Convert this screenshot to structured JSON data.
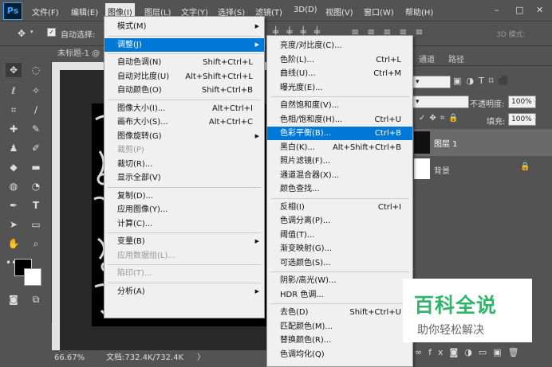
{
  "app": {
    "logo": "Ps"
  },
  "menubar": {
    "items": [
      "文件(F)",
      "编辑(E)",
      "图像(I)",
      "图层(L)",
      "文字(Y)",
      "选择(S)",
      "滤镜(T)",
      "3D(D)",
      "视图(V)",
      "窗口(W)",
      "帮助(H)"
    ],
    "window_controls": [
      "–",
      "□",
      "✕"
    ]
  },
  "options": {
    "auto_select_label": "自动选择:",
    "mode_label": "3D 模式:"
  },
  "document": {
    "tab_title": "未标题-1 @",
    "zoom": "66.67%",
    "doc_info": "文档:732.4K/732.4K",
    "status_arrow": "〉"
  },
  "image_menu": {
    "items": [
      {
        "label": "模式(M)",
        "shortcut": "",
        "submenu": true,
        "disabled": false
      },
      {
        "sep": true
      },
      {
        "label": "调整(J)",
        "shortcut": "",
        "submenu": true,
        "disabled": false,
        "highlight": true
      },
      {
        "sep": true
      },
      {
        "label": "自动色调(N)",
        "shortcut": "Shift+Ctrl+L"
      },
      {
        "label": "自动对比度(U)",
        "shortcut": "Alt+Shift+Ctrl+L"
      },
      {
        "label": "自动颜色(O)",
        "shortcut": "Shift+Ctrl+B"
      },
      {
        "sep": true
      },
      {
        "label": "图像大小(I)...",
        "shortcut": "Alt+Ctrl+I"
      },
      {
        "label": "画布大小(S)...",
        "shortcut": "Alt+Ctrl+C"
      },
      {
        "label": "图像旋转(G)",
        "shortcut": "",
        "submenu": true
      },
      {
        "label": "裁剪(P)",
        "shortcut": "",
        "disabled": true
      },
      {
        "label": "裁切(R)...",
        "shortcut": ""
      },
      {
        "label": "显示全部(V)",
        "shortcut": ""
      },
      {
        "sep": true
      },
      {
        "label": "复制(D)...",
        "shortcut": ""
      },
      {
        "label": "应用图像(Y)...",
        "shortcut": ""
      },
      {
        "label": "计算(C)...",
        "shortcut": ""
      },
      {
        "sep": true
      },
      {
        "label": "变量(B)",
        "shortcut": "",
        "submenu": true
      },
      {
        "label": "应用数据组(L)...",
        "shortcut": "",
        "disabled": true
      },
      {
        "sep": true
      },
      {
        "label": "陷印(T)...",
        "shortcut": "",
        "disabled": true
      },
      {
        "sep": true
      },
      {
        "label": "分析(A)",
        "shortcut": "",
        "submenu": true
      }
    ]
  },
  "adjust_menu": {
    "items": [
      {
        "label": "亮度/对比度(C)...",
        "shortcut": ""
      },
      {
        "label": "色阶(L)...",
        "shortcut": "Ctrl+L"
      },
      {
        "label": "曲线(U)...",
        "shortcut": "Ctrl+M"
      },
      {
        "label": "曝光度(E)...",
        "shortcut": ""
      },
      {
        "sep": true
      },
      {
        "label": "自然饱和度(V)...",
        "shortcut": ""
      },
      {
        "label": "色相/饱和度(H)...",
        "shortcut": "Ctrl+U"
      },
      {
        "label": "色彩平衡(B)...",
        "shortcut": "Ctrl+B",
        "highlight": true
      },
      {
        "label": "黑白(K)...",
        "shortcut": "Alt+Shift+Ctrl+B"
      },
      {
        "label": "照片滤镜(F)...",
        "shortcut": ""
      },
      {
        "label": "通道混合器(X)...",
        "shortcut": ""
      },
      {
        "label": "颜色查找...",
        "shortcut": ""
      },
      {
        "sep": true
      },
      {
        "label": "反相(I)",
        "shortcut": "Ctrl+I"
      },
      {
        "label": "色调分离(P)...",
        "shortcut": ""
      },
      {
        "label": "阈值(T)...",
        "shortcut": ""
      },
      {
        "label": "渐变映射(G)...",
        "shortcut": ""
      },
      {
        "label": "可选颜色(S)...",
        "shortcut": ""
      },
      {
        "sep": true
      },
      {
        "label": "阴影/高光(W)...",
        "shortcut": ""
      },
      {
        "label": "HDR 色调...",
        "shortcut": ""
      },
      {
        "sep": true
      },
      {
        "label": "去色(D)",
        "shortcut": "Shift+Ctrl+U"
      },
      {
        "label": "匹配颜色(M)...",
        "shortcut": ""
      },
      {
        "label": "替换颜色(R)...",
        "shortcut": ""
      },
      {
        "label": "色调均化(Q)",
        "shortcut": ""
      }
    ]
  },
  "panel": {
    "tabs": [
      "通道",
      "路径"
    ],
    "opacity_label": "不透明度:",
    "opacity_value": "100%",
    "fill_label": "填充:",
    "fill_value": "100%",
    "layers": [
      {
        "name": "图层 1"
      },
      {
        "name": "背景"
      }
    ]
  },
  "watermark": {
    "title": "百科全说",
    "subtitle": "助你轻松解决"
  },
  "colors": {
    "highlight": "#0078d7",
    "menu_bg": "#f0f0f0",
    "ui_bg": "#535353",
    "brand_green": "#31b56c"
  }
}
